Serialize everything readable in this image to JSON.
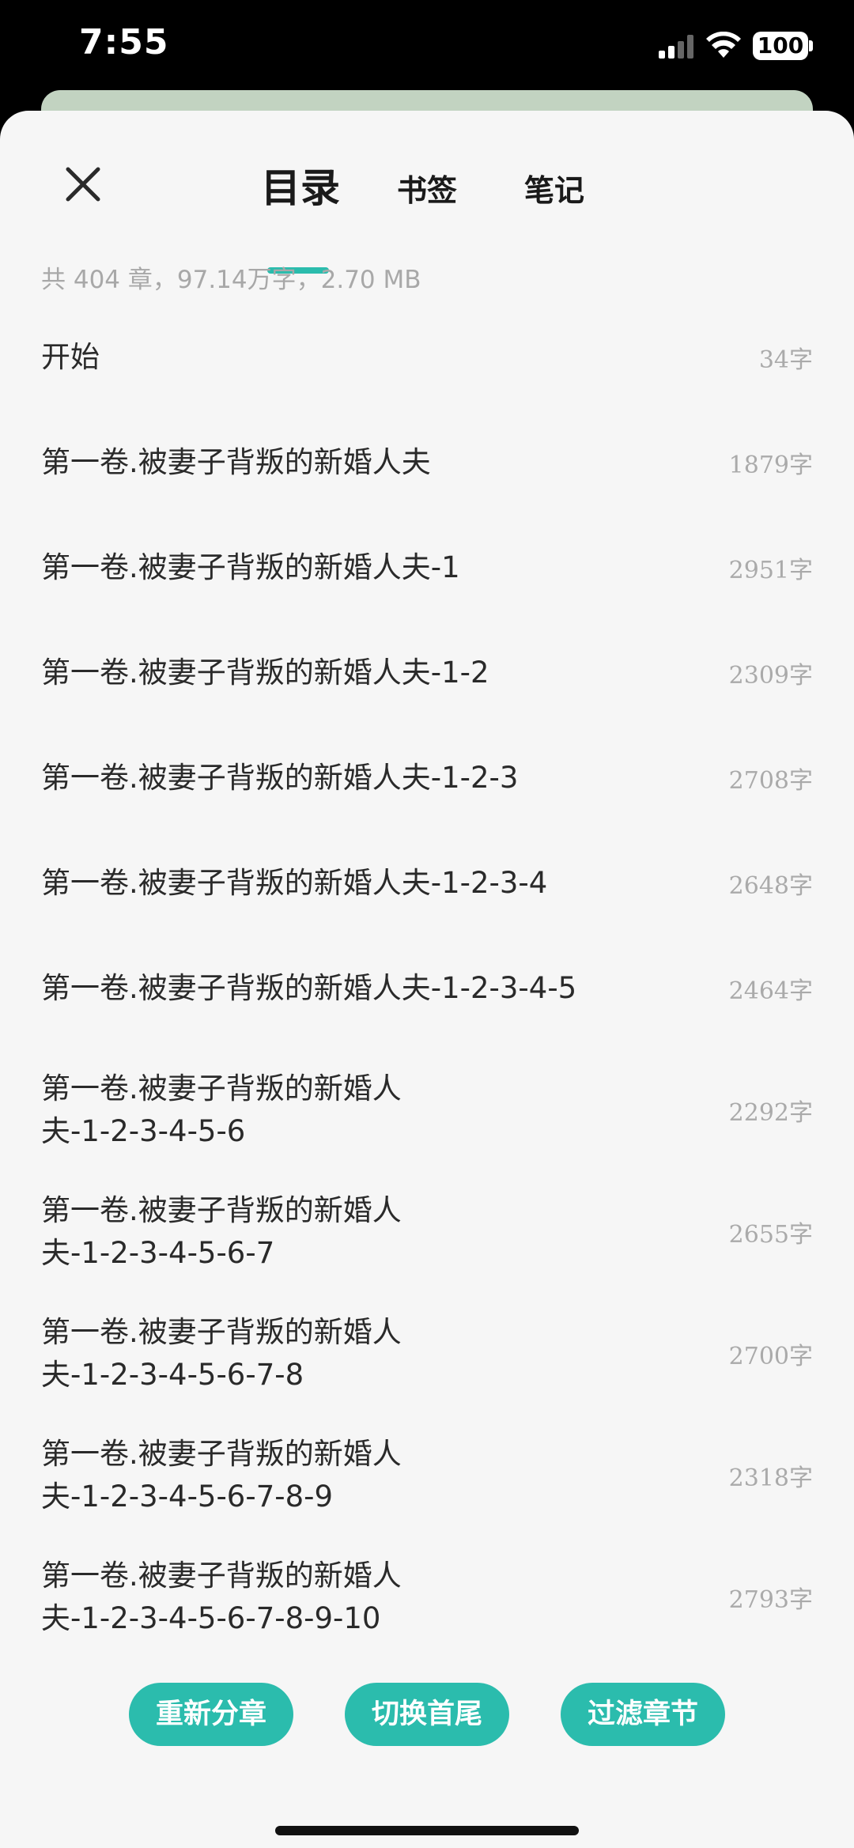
{
  "status_bar": {
    "time": "7:55",
    "battery": "100"
  },
  "tabs": {
    "toc": "目录",
    "bookmarks": "书签",
    "notes": "笔记"
  },
  "summary": "共 404 章，97.14万字，2.70 MB",
  "chapters": [
    {
      "title": "开始",
      "count": "34字"
    },
    {
      "title": "第一卷.被妻子背叛的新婚人夫",
      "count": "1879字"
    },
    {
      "title": "第一卷.被妻子背叛的新婚人夫-1",
      "count": "2951字"
    },
    {
      "title": "第一卷.被妻子背叛的新婚人夫-1-2",
      "count": "2309字"
    },
    {
      "title": "第一卷.被妻子背叛的新婚人夫-1-2-3",
      "count": "2708字"
    },
    {
      "title": "第一卷.被妻子背叛的新婚人夫-1-2-3-4",
      "count": "2648字"
    },
    {
      "title": "第一卷.被妻子背叛的新婚人夫-1-2-3-4-5",
      "count": "2464字"
    },
    {
      "title": "第一卷.被妻子背叛的新婚人夫-1-2-3-4-5-6",
      "count": "2292字"
    },
    {
      "title": "第一卷.被妻子背叛的新婚人夫-1-2-3-4-5-6-7",
      "count": "2655字"
    },
    {
      "title": "第一卷.被妻子背叛的新婚人夫-1-2-3-4-5-6-7-8",
      "count": "2700字"
    },
    {
      "title": "第一卷.被妻子背叛的新婚人夫-1-2-3-4-5-6-7-8-9",
      "count": "2318字"
    },
    {
      "title": "第一卷.被妻子背叛的新婚人夫-1-2-3-4-5-6-7-8-9-10",
      "count": "2793字"
    }
  ],
  "actions": {
    "resplit": "重新分章",
    "toggle_order": "切换首尾",
    "filter": "过滤章节"
  },
  "colors": {
    "accent": "#2bbcad",
    "background": "#f6f6f6"
  },
  "icons": [
    "close-icon",
    "signal-icon",
    "wifi-icon",
    "battery-icon"
  ]
}
